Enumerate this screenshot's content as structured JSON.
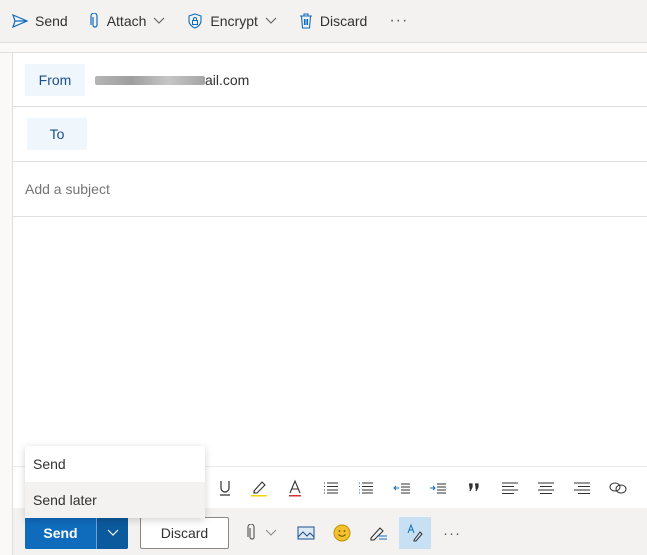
{
  "command_bar": {
    "send_label": "Send",
    "attach_label": "Attach",
    "encrypt_label": "Encrypt",
    "discard_label": "Discard",
    "more_label": "···"
  },
  "header": {
    "from_label": "From",
    "from_value_visible_suffix": "ail.com",
    "to_label": "To",
    "to_value": "",
    "subject_placeholder": "Add a subject",
    "subject_value": ""
  },
  "body": {
    "text": ""
  },
  "formatting_toolbar": {
    "icons": [
      "underline-icon",
      "highlight-icon",
      "font-color-icon",
      "bullets-icon",
      "numbering-icon",
      "decrease-indent-icon",
      "increase-indent-icon",
      "quote-icon",
      "align-left-icon",
      "align-center-icon",
      "align-right-icon",
      "link-icon"
    ]
  },
  "bottom_bar": {
    "send_label": "Send",
    "discard_label": "Discard",
    "more_label": "···",
    "icons": [
      "attach-icon",
      "insert-picture-icon",
      "emoji-icon",
      "signature-icon",
      "format-text-icon"
    ]
  },
  "send_menu": {
    "items": [
      {
        "label": "Send",
        "highlighted": false
      },
      {
        "label": "Send later",
        "highlighted": true
      }
    ]
  },
  "colors": {
    "accent": "#0f6cbd",
    "accent_dark": "#0b5a9d",
    "chip_bg": "#eff6fc",
    "chip_text": "#1b4f8a",
    "toolbar_bg": "#f3f2f1",
    "emoji_yellow": "#f2c12e"
  }
}
